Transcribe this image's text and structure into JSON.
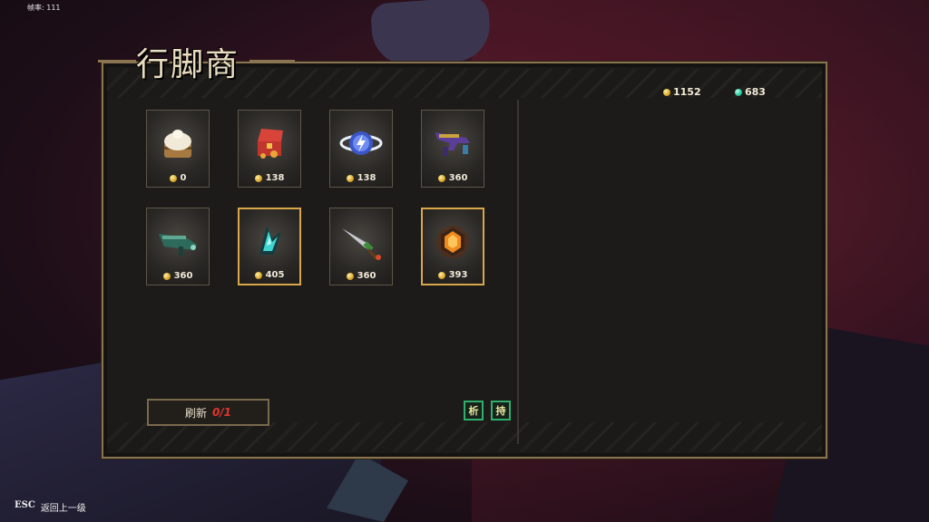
{
  "hud": {
    "fps": "帧率: 111"
  },
  "shop": {
    "title": "行脚商",
    "gold": "1152",
    "gems": "683",
    "items": [
      {
        "name": "steamed-bun-icon",
        "price": "0",
        "highlighted": false
      },
      {
        "name": "treasure-chest-icon",
        "price": "138",
        "highlighted": false
      },
      {
        "name": "lightning-orb-icon",
        "price": "138",
        "highlighted": false
      },
      {
        "name": "purple-gun-icon",
        "price": "360",
        "highlighted": false
      },
      {
        "name": "green-cannon-icon",
        "price": "360",
        "highlighted": false
      },
      {
        "name": "cyan-claw-icon",
        "price": "405",
        "highlighted": true
      },
      {
        "name": "dagger-icon",
        "price": "360",
        "highlighted": false
      },
      {
        "name": "amber-gem-icon",
        "price": "393",
        "highlighted": true
      }
    ],
    "refresh": {
      "label": "刷新",
      "count": "0/1"
    },
    "buttons": {
      "sell": "析",
      "hold": "持"
    }
  },
  "footer": {
    "key": "ESC",
    "label": "返回上一级"
  }
}
